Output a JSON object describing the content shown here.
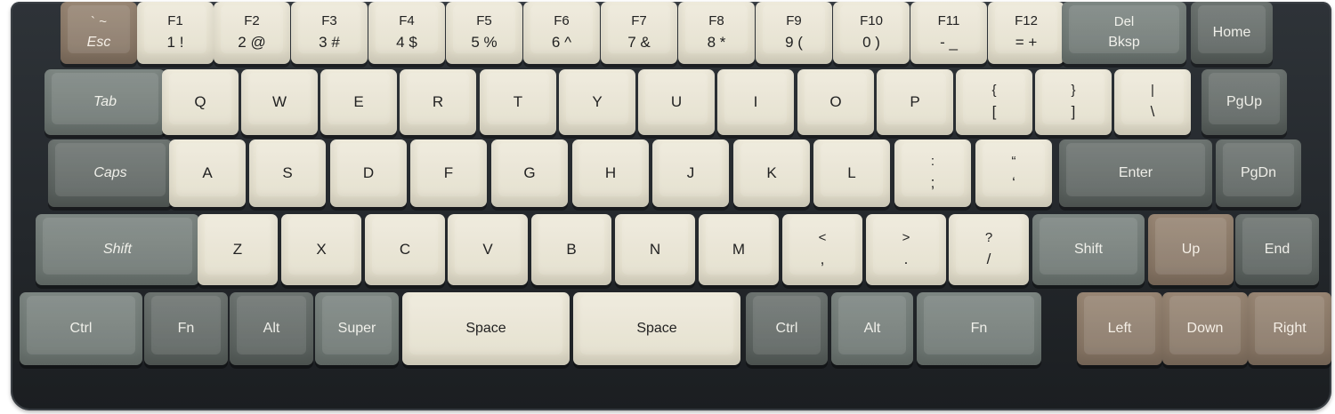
{
  "keyboard": {
    "rows": [
      [
        {
          "name": "esc",
          "top": "` ~",
          "bot": "Esc",
          "color": "brown",
          "cls": "mod"
        },
        {
          "name": "f1",
          "top": "F1",
          "bot": "1  !",
          "color": "beige"
        },
        {
          "name": "f2",
          "top": "F2",
          "bot": "2 @",
          "color": "beige"
        },
        {
          "name": "f3",
          "top": "F3",
          "bot": "3  #",
          "color": "beige"
        },
        {
          "name": "f4",
          "top": "F4",
          "bot": "4  $",
          "color": "beige"
        },
        {
          "name": "f5",
          "top": "F5",
          "bot": "5 %",
          "color": "beige"
        },
        {
          "name": "f6",
          "top": "F6",
          "bot": "6  ^",
          "color": "beige"
        },
        {
          "name": "f7",
          "top": "F7",
          "bot": "7 &",
          "color": "beige"
        },
        {
          "name": "f8",
          "top": "F8",
          "bot": "8  *",
          "color": "beige"
        },
        {
          "name": "f9",
          "top": "F9",
          "bot": "9  (",
          "color": "beige"
        },
        {
          "name": "f10",
          "top": "F10",
          "bot": "0  )",
          "color": "beige"
        },
        {
          "name": "f11",
          "top": "F11",
          "bot": "-  _",
          "color": "beige"
        },
        {
          "name": "f12",
          "top": "F12",
          "bot": "=  +",
          "color": "beige"
        },
        {
          "name": "del-bksp",
          "top": "Del",
          "bot": "Bksp",
          "color": "gray",
          "cls": "mod2"
        },
        {
          "name": "home",
          "top": "",
          "bot": "Home",
          "color": "dgray",
          "cls": "mod2"
        }
      ],
      [
        {
          "name": "tab",
          "top": "",
          "bot": "Tab",
          "color": "gray",
          "cls": "mod"
        },
        {
          "name": "q",
          "top": "",
          "bot": "Q",
          "color": "beige"
        },
        {
          "name": "w",
          "top": "",
          "bot": "W",
          "color": "beige"
        },
        {
          "name": "e",
          "top": "",
          "bot": "E",
          "color": "beige"
        },
        {
          "name": "r",
          "top": "",
          "bot": "R",
          "color": "beige"
        },
        {
          "name": "t",
          "top": "",
          "bot": "T",
          "color": "beige"
        },
        {
          "name": "y",
          "top": "",
          "bot": "Y",
          "color": "beige"
        },
        {
          "name": "u",
          "top": "",
          "bot": "U",
          "color": "beige"
        },
        {
          "name": "i",
          "top": "",
          "bot": "I",
          "color": "beige"
        },
        {
          "name": "o",
          "top": "",
          "bot": "O",
          "color": "beige"
        },
        {
          "name": "p",
          "top": "",
          "bot": "P",
          "color": "beige"
        },
        {
          "name": "bracket-left",
          "top": "{",
          "bot": "[",
          "color": "beige"
        },
        {
          "name": "bracket-right",
          "top": "}",
          "bot": "]",
          "color": "beige"
        },
        {
          "name": "backslash",
          "top": "|",
          "bot": "\\",
          "color": "beige"
        },
        {
          "name": "pgup",
          "top": "",
          "bot": "PgUp",
          "color": "dgray",
          "cls": "mod2"
        }
      ],
      [
        {
          "name": "caps",
          "top": "",
          "bot": "Caps",
          "color": "dgray",
          "cls": "mod"
        },
        {
          "name": "a",
          "top": "",
          "bot": "A",
          "color": "beige"
        },
        {
          "name": "s",
          "top": "",
          "bot": "S",
          "color": "beige"
        },
        {
          "name": "d",
          "top": "",
          "bot": "D",
          "color": "beige"
        },
        {
          "name": "f",
          "top": "",
          "bot": "F",
          "color": "beige"
        },
        {
          "name": "g",
          "top": "",
          "bot": "G",
          "color": "beige"
        },
        {
          "name": "h",
          "top": "",
          "bot": "H",
          "color": "beige"
        },
        {
          "name": "j",
          "top": "",
          "bot": "J",
          "color": "beige"
        },
        {
          "name": "k",
          "top": "",
          "bot": "K",
          "color": "beige"
        },
        {
          "name": "l",
          "top": "",
          "bot": "L",
          "color": "beige"
        },
        {
          "name": "semicolon",
          "top": ":",
          "bot": ";",
          "color": "beige"
        },
        {
          "name": "quote",
          "top": "“",
          "bot": "‘",
          "color": "beige"
        },
        {
          "name": "enter",
          "top": "",
          "bot": "Enter",
          "color": "dgray",
          "cls": "mod2"
        },
        {
          "name": "pgdn",
          "top": "",
          "bot": "PgDn",
          "color": "dgray",
          "cls": "mod2"
        }
      ],
      [
        {
          "name": "shift-left",
          "top": "",
          "bot": "Shift",
          "color": "gray",
          "cls": "mod"
        },
        {
          "name": "z",
          "top": "",
          "bot": "Z",
          "color": "beige"
        },
        {
          "name": "x",
          "top": "",
          "bot": "X",
          "color": "beige"
        },
        {
          "name": "c",
          "top": "",
          "bot": "C",
          "color": "beige"
        },
        {
          "name": "v",
          "top": "",
          "bot": "V",
          "color": "beige"
        },
        {
          "name": "b",
          "top": "",
          "bot": "B",
          "color": "beige"
        },
        {
          "name": "n",
          "top": "",
          "bot": "N",
          "color": "beige"
        },
        {
          "name": "m",
          "top": "",
          "bot": "M",
          "color": "beige"
        },
        {
          "name": "comma",
          "top": "<",
          "bot": ",",
          "color": "beige"
        },
        {
          "name": "period",
          "top": ">",
          "bot": ".",
          "color": "beige"
        },
        {
          "name": "slash",
          "top": "?",
          "bot": "/",
          "color": "beige"
        },
        {
          "name": "shift-right",
          "top": "",
          "bot": "Shift",
          "color": "gray",
          "cls": "mod2"
        },
        {
          "name": "up",
          "top": "",
          "bot": "Up",
          "color": "brown",
          "cls": "mod2"
        },
        {
          "name": "end",
          "top": "",
          "bot": "End",
          "color": "dgray",
          "cls": "mod2"
        }
      ],
      [
        {
          "name": "ctrl-left",
          "top": "",
          "bot": "Ctrl",
          "color": "gray",
          "cls": "mod2"
        },
        {
          "name": "fn-left",
          "top": "",
          "bot": "Fn",
          "color": "dgray",
          "cls": "mod2"
        },
        {
          "name": "alt-left",
          "top": "",
          "bot": "Alt",
          "color": "dgray",
          "cls": "mod2"
        },
        {
          "name": "super",
          "top": "",
          "bot": "Super",
          "color": "gray",
          "cls": "mod2"
        },
        {
          "name": "space-left",
          "top": "",
          "bot": "Space",
          "color": "beige",
          "cls": "mod2"
        },
        {
          "name": "space-right",
          "top": "",
          "bot": "Space",
          "color": "beige",
          "cls": "mod2"
        },
        {
          "name": "ctrl-right",
          "top": "",
          "bot": "Ctrl",
          "color": "dgray",
          "cls": "mod2"
        },
        {
          "name": "alt-right",
          "top": "",
          "bot": "Alt",
          "color": "gray",
          "cls": "mod2"
        },
        {
          "name": "fn-right",
          "top": "",
          "bot": "Fn",
          "color": "gray",
          "cls": "mod2"
        },
        {
          "name": "left",
          "top": "",
          "bot": "Left",
          "color": "brown",
          "cls": "mod2"
        },
        {
          "name": "down",
          "top": "",
          "bot": "Down",
          "color": "brown",
          "cls": "mod2"
        },
        {
          "name": "right",
          "top": "",
          "bot": "Right",
          "color": "brown",
          "cls": "mod2"
        }
      ]
    ]
  }
}
